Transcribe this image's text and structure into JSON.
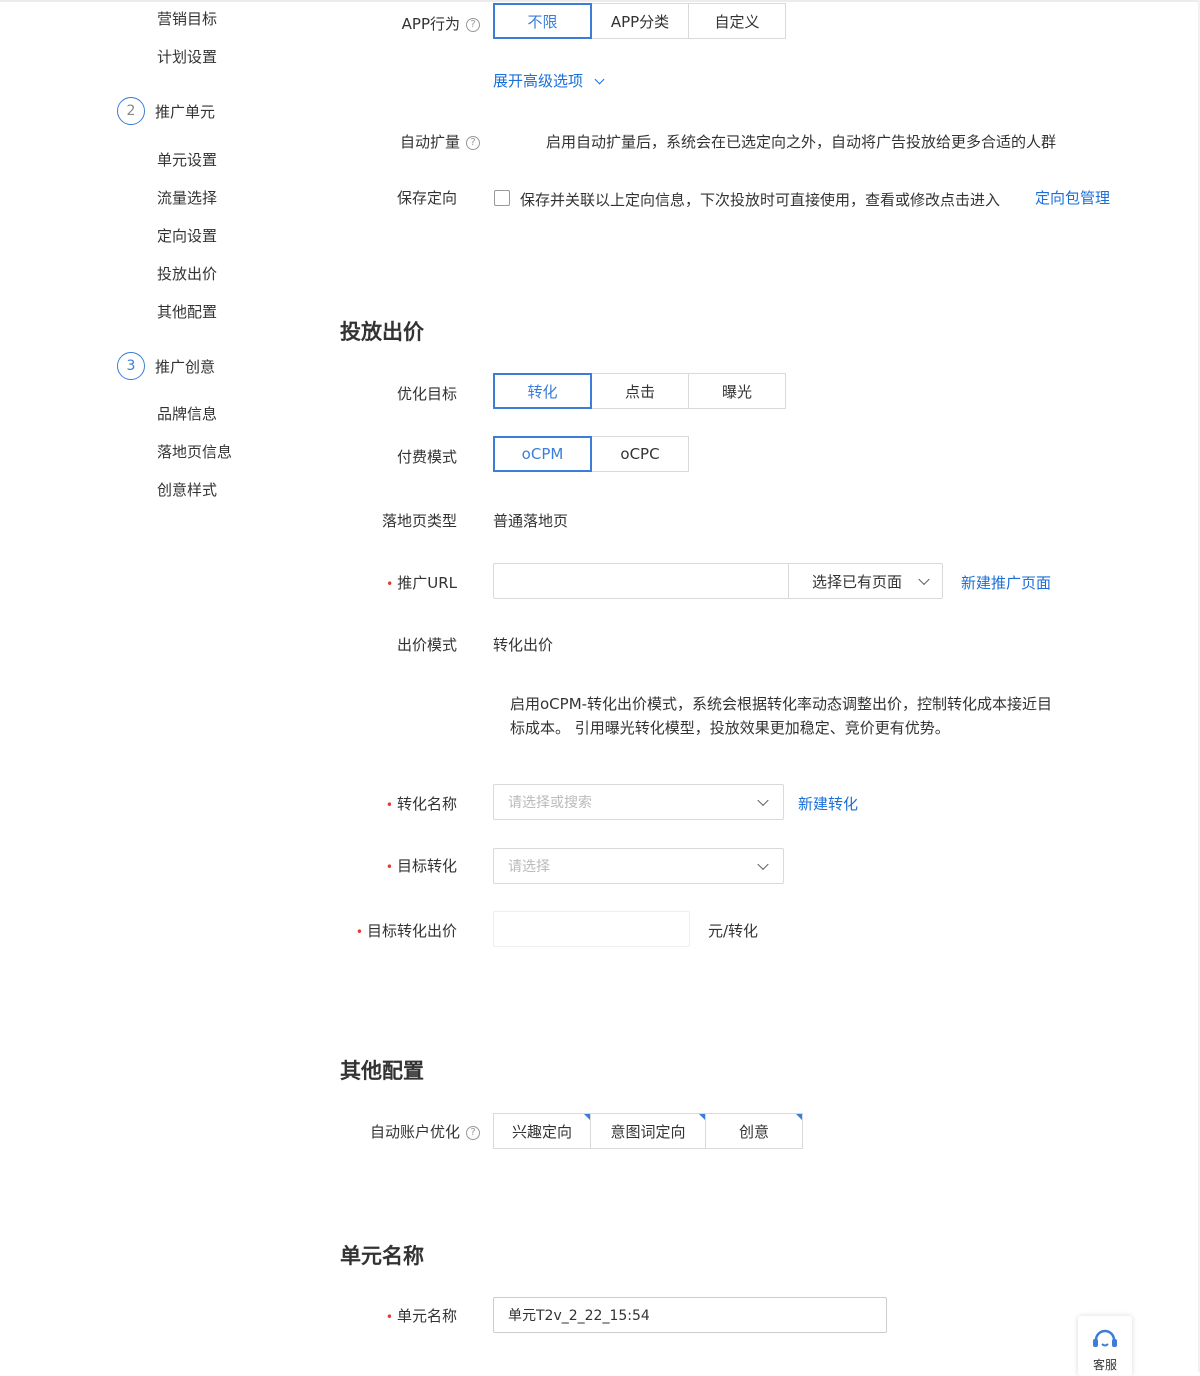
{
  "sidebar": {
    "items_top": [
      "营销目标",
      "计划设置"
    ],
    "step2": {
      "num": "2",
      "label": "推广单元"
    },
    "step2_items": [
      "单元设置",
      "流量选择",
      "定向设置",
      "投放出价",
      "其他配置"
    ],
    "step3": {
      "num": "3",
      "label": "推广创意"
    },
    "step3_items": [
      "品牌信息",
      "落地页信息",
      "创意样式"
    ]
  },
  "targeting": {
    "app_behavior": {
      "label": "APP行为",
      "options": [
        "不限",
        "APP分类",
        "自定义"
      ],
      "selected": "不限"
    },
    "expand_advanced": "展开高级选项",
    "auto_expand": {
      "label": "自动扩量",
      "description": "启用自动扩量后，系统会在已选定向之外，自动将广告投放给更多合适的人群"
    },
    "save_targeting": {
      "label": "保存定向",
      "checkbox_text": "保存并关联以上定向信息，下次投放时可直接使用，查看或修改点击进入",
      "link": "定向包管理"
    }
  },
  "bidding": {
    "section_title": "投放出价",
    "opt_goal": {
      "label": "优化目标",
      "options": [
        "转化",
        "点击",
        "曝光"
      ],
      "selected": "转化"
    },
    "pay_mode": {
      "label": "付费模式",
      "options": [
        "oCPM",
        "oCPC"
      ],
      "selected": "oCPM"
    },
    "landing_type": {
      "label": "落地页类型",
      "value": "普通落地页"
    },
    "promo_url": {
      "label": "推广URL",
      "value": "",
      "select_label": "选择已有页面",
      "new_link": "新建推广页面"
    },
    "bid_mode": {
      "label": "出价模式",
      "value": "转化出价"
    },
    "bid_desc_line1": "启用oCPM-转化出价模式，系统会根据转化率动态调整出价，控制转化成本接近目",
    "bid_desc_line2": "标成本。 引用曝光转化模型，投放效果更加稳定、竞价更有优势。",
    "conv_name": {
      "label": "转化名称",
      "placeholder": "请选择或搜索",
      "new_link": "新建转化"
    },
    "target_conv": {
      "label": "目标转化",
      "placeholder": "请选择"
    },
    "target_bid": {
      "label": "目标转化出价",
      "value": "",
      "unit": "元/转化"
    }
  },
  "other": {
    "section_title": "其他配置",
    "auto_opt": {
      "label": "自动账户优化",
      "options": [
        "兴趣定向",
        "意图词定向",
        "创意"
      ]
    }
  },
  "unit_name": {
    "section_title": "单元名称",
    "label": "单元名称",
    "value": "单元T2v_2_22_15:54"
  },
  "service": {
    "label": "客服"
  },
  "colors": {
    "accent": "#3b7dd8",
    "link": "#1a6fd8",
    "required": "#e53935"
  }
}
